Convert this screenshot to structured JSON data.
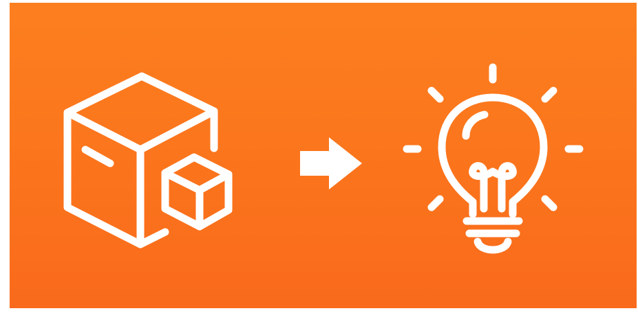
{
  "banner": {
    "background_top": "#fc7f1f",
    "background_bottom": "#f96a1c",
    "icon_color": "#ffffff"
  },
  "icons": {
    "left": "boxes-icon",
    "middle": "arrow-right-icon",
    "right": "lightbulb-icon"
  }
}
